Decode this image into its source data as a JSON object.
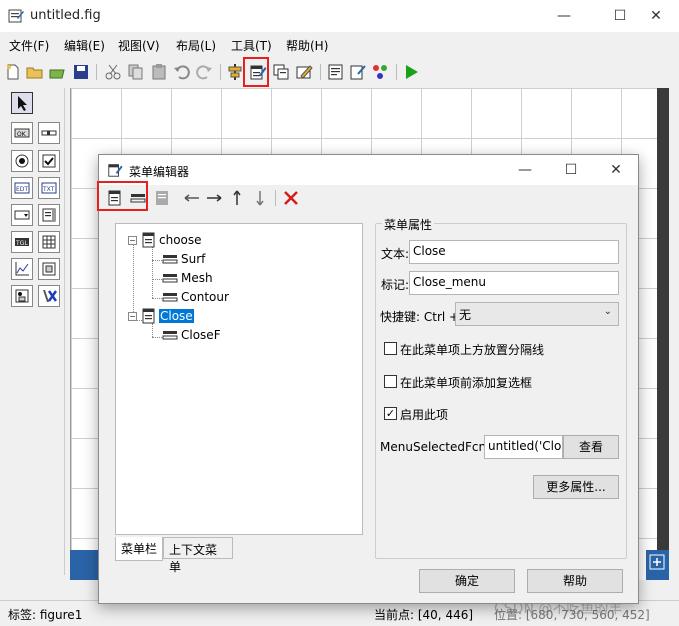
{
  "window": {
    "title": "untitled.fig",
    "minimize": "—",
    "maximize": "☐",
    "close": "✕"
  },
  "menubar": [
    "文件(F)",
    "编辑(E)",
    "视图(V)",
    "布局(L)",
    "工具(T)",
    "帮助(H)"
  ],
  "dialog": {
    "title": "菜单编辑器",
    "minimize": "—",
    "maximize": "☐",
    "close": "✕",
    "tree": {
      "menus": [
        {
          "label": "choose",
          "children": [
            "Surf",
            "Mesh",
            "Contour"
          ]
        },
        {
          "label": "Close",
          "children": [
            "CloseF"
          ],
          "selected": true
        }
      ]
    },
    "tabs": [
      "菜单栏",
      "上下文菜单"
    ],
    "props": {
      "group_title": "菜单属性",
      "text_label": "文本:",
      "text_value": "Close",
      "tag_label": "标记:",
      "tag_value": "Close_menu",
      "accel_label": "快捷键: Ctrl +",
      "accel_value": "无",
      "separator_label": "在此菜单项上方放置分隔线",
      "separator_checked": false,
      "checked_label": "在此菜单项前添加复选框",
      "checked_checked": false,
      "enable_label": "启用此项",
      "enable_checked": true,
      "callback_label": "MenuSelectedFcn:",
      "callback_value": "untitled('Clos",
      "view_button": "查看",
      "more_button": "更多属性..."
    },
    "ok_button": "确定",
    "help_button": "帮助"
  },
  "statusbar": {
    "tag_text": "标签: figure1",
    "current_point": "当前点:  [40, 446]",
    "position_text": "位置: [680, 730, 560, 452]"
  },
  "watermark": "CSDN @不吃鱼的羊",
  "colors": {
    "highlight": "#e52020",
    "selection": "#0078d7",
    "figure_bar": "#2a64a8"
  }
}
